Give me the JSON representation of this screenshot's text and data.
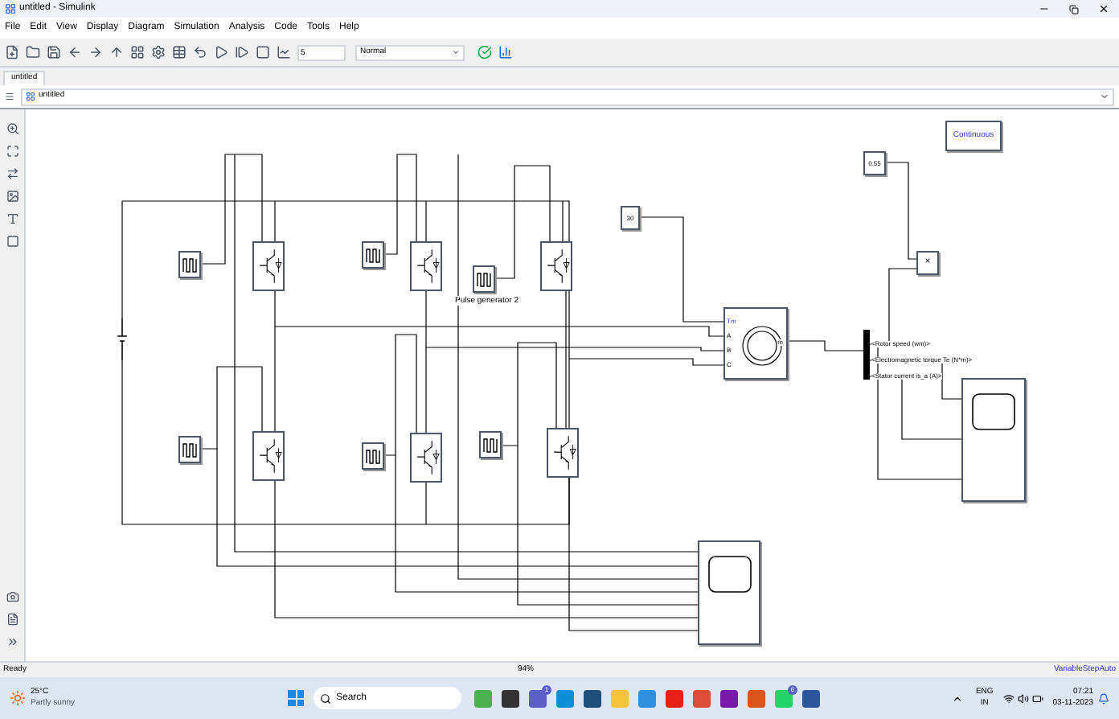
{
  "window": {
    "title": "untitled - Simulink"
  },
  "menu": [
    "File",
    "Edit",
    "View",
    "Display",
    "Diagram",
    "Simulation",
    "Analysis",
    "Code",
    "Tools",
    "Help"
  ],
  "toolbar": {
    "stop_time": "5",
    "sim_mode": "Normal"
  },
  "tabs": [
    {
      "label": "untitled",
      "selected": true
    }
  ],
  "breadcrumb": "untitled",
  "blocks": [
    {
      "kind": "dc"
    },
    {
      "kind": "pulse"
    },
    {
      "kind": "pulse"
    },
    {
      "kind": "pulse",
      "label": "Pulse generator 2"
    },
    {
      "kind": "pulse"
    },
    {
      "kind": "pulse"
    },
    {
      "kind": "pulse"
    },
    {
      "kind": "igbt"
    },
    {
      "kind": "igbt"
    },
    {
      "kind": "igbt"
    },
    {
      "kind": "igbt"
    },
    {
      "kind": "igbt"
    },
    {
      "kind": "igbt"
    },
    {
      "kind": "constant",
      "text": "30"
    },
    {
      "kind": "constant",
      "text": "0.55"
    },
    {
      "kind": "product",
      "text": "×"
    },
    {
      "kind": "powergui",
      "text": "Continuous"
    },
    {
      "kind": "motor",
      "ports": [
        "Tm",
        "A",
        "B",
        "C"
      ],
      "output": "m"
    },
    {
      "kind": "bus",
      "signals": [
        "<Rotor speed (wm)>",
        "<Electromagnetic torque Te (N*m)>",
        "<Stator current is_a (A)>"
      ]
    },
    {
      "kind": "scope"
    },
    {
      "kind": "scope"
    }
  ],
  "status_bar": {
    "state": "Ready",
    "zoom": "94%",
    "solver": "VariableStepAuto"
  },
  "taskbar": {
    "weather": {
      "temp": "25°C",
      "desc": "Partly sunny"
    },
    "search": "Search",
    "apps": [
      {
        "kind": "gif"
      },
      {
        "kind": "files"
      },
      {
        "kind": "chat",
        "badge": "1"
      },
      {
        "kind": "edge"
      },
      {
        "kind": "store"
      },
      {
        "kind": "folder"
      },
      {
        "kind": "help"
      },
      {
        "kind": "youtube"
      },
      {
        "kind": "chrome"
      },
      {
        "kind": "onenote"
      },
      {
        "kind": "matlab"
      },
      {
        "kind": "whatsapp",
        "badge": "6"
      },
      {
        "kind": "word"
      }
    ],
    "language": "ENG",
    "region": "IN",
    "time": "07:21",
    "date": "03-11-2023"
  }
}
